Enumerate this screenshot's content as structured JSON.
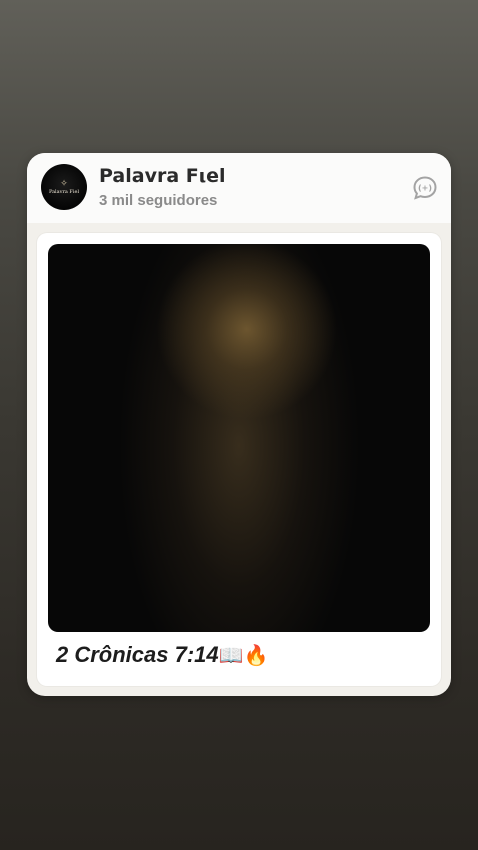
{
  "channel": {
    "name": "Palavra Fιel",
    "followers": "3 mil seguidores",
    "avatar_text": "Palavra Fiel",
    "avatar_icon": "open-book-icon"
  },
  "post": {
    "caption": "2 Crônicas 7:14",
    "caption_emojis": "📖🔥"
  },
  "icons": {
    "reply": "chat-bubble-icon"
  },
  "colors": {
    "background_top": "#616059",
    "background_bottom": "#27241f",
    "card": "#f2f0eb",
    "name_text": "#2b2b2b",
    "followers_text": "#8a8a8a"
  }
}
